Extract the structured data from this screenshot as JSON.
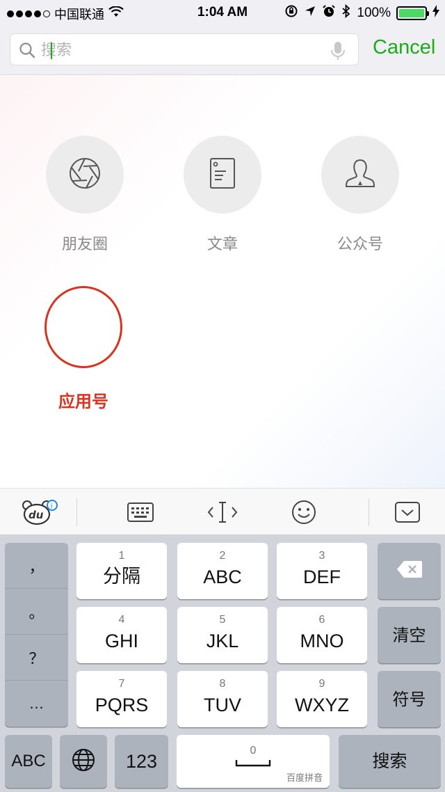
{
  "status_bar": {
    "carrier": "中国联通",
    "time": "1:04 AM",
    "battery": "100%"
  },
  "search": {
    "placeholder": "搜索",
    "cancel_label": "Cancel"
  },
  "categories": [
    {
      "label": "朋友圈",
      "icon": "camera-aperture-icon"
    },
    {
      "label": "文章",
      "icon": "document-icon"
    },
    {
      "label": "公众号",
      "icon": "official-account-icon"
    },
    {
      "label": "应用号",
      "icon": "empty-highlighted-circle"
    }
  ],
  "keyboard_toolbar": {
    "icons": [
      "baidu-du-logo-icon",
      "keyboard-icon",
      "cursor-move-icon",
      "emoji-icon",
      "hide-keyboard-icon"
    ]
  },
  "keyboard": {
    "punctuation": [
      "，",
      "。",
      "？",
      "…"
    ],
    "keys": [
      {
        "num": "1",
        "letters": "分隔"
      },
      {
        "num": "2",
        "letters": "ABC"
      },
      {
        "num": "3",
        "letters": "DEF"
      },
      {
        "num": "4",
        "letters": "GHI"
      },
      {
        "num": "5",
        "letters": "JKL"
      },
      {
        "num": "6",
        "letters": "MNO"
      },
      {
        "num": "7",
        "letters": "PQRS"
      },
      {
        "num": "8",
        "letters": "TUV"
      },
      {
        "num": "9",
        "letters": "WXYZ"
      }
    ],
    "clear_label": "清空",
    "symbol_label": "符号",
    "abc_label": "ABC",
    "num_label": "123",
    "space_num": "0",
    "brand": "百度拼音",
    "search_label": "搜索"
  },
  "colors": {
    "accent_green": "#1aad19",
    "highlight_red": "#d9331f"
  }
}
